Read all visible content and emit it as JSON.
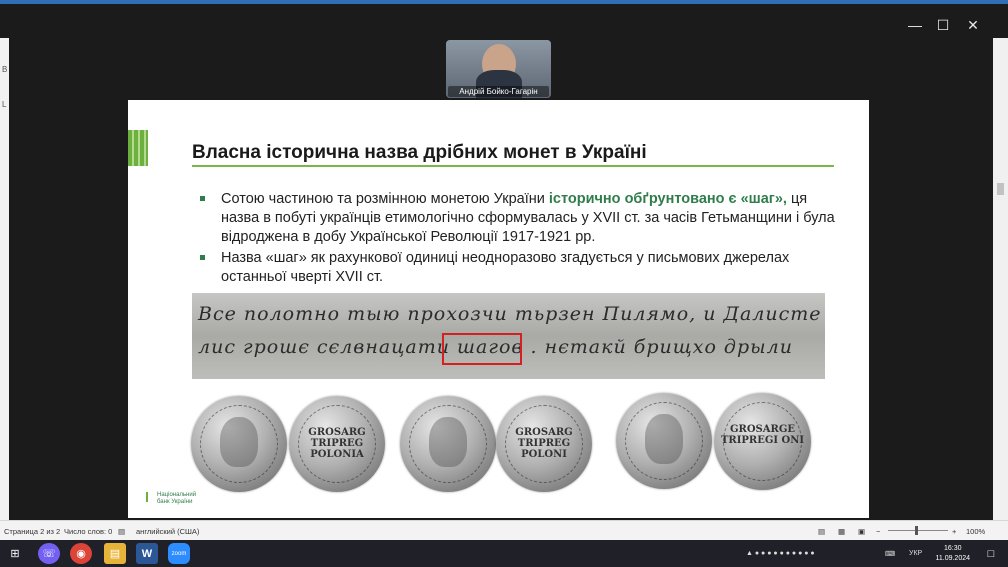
{
  "window": {
    "minimize_icon": "minimize-icon",
    "maximize_icon": "maximize-icon",
    "close_icon": "close-icon"
  },
  "participant": {
    "name": "Андрій Бойко-Гагарін"
  },
  "slide": {
    "title": "Власна історична назва дрібних монет в Україні",
    "bullet1": {
      "text_before": "Сотою частиною та розмінною монетою України ",
      "highlight": "історично обґрунтовано є «шаг»,",
      "text_after": " ця назва в побуті українців етимологічно сформувалась у XVII ст. за часів Гетьманщини і була відроджена в добу Української Революції 1917-1921 рр."
    },
    "bullet2": "Назва «шаг» як рахункової одиниці неодноразово згадується у письмових джерелах останньої чверті XVII ст.",
    "manuscript_line1": "Все полотно тыю прохозчи тьрзен Пилямо, и Далисте",
    "manuscript_line2": "лис грошє сєлвнацати шагов . нєтакй брищхо дрыли",
    "coin_texts": [
      "",
      "GROSARG TRIPREG POLONIA",
      "",
      "GROSARG TRIPREG POLONI",
      "",
      "GROSARGE TRIPREGI ONI"
    ],
    "logo_line1": "Національний",
    "logo_line2": "банк України"
  },
  "statusbar": {
    "page": "Страница 2 из 2",
    "words": "Число слов: 0",
    "language": "английский (США)",
    "zoom": "100%"
  },
  "taskbar": {
    "icons": [
      "windows-start-icon",
      "viber-icon",
      "chrome-icon",
      "file-explorer-icon",
      "word-icon",
      "zoom-icon"
    ],
    "language": "УКР",
    "time": "16:30",
    "date": "11.09.2024"
  },
  "colors": {
    "accent_green": "#2f7d4a",
    "rule_green": "#7ab648",
    "highlight_box": "#d42020"
  }
}
